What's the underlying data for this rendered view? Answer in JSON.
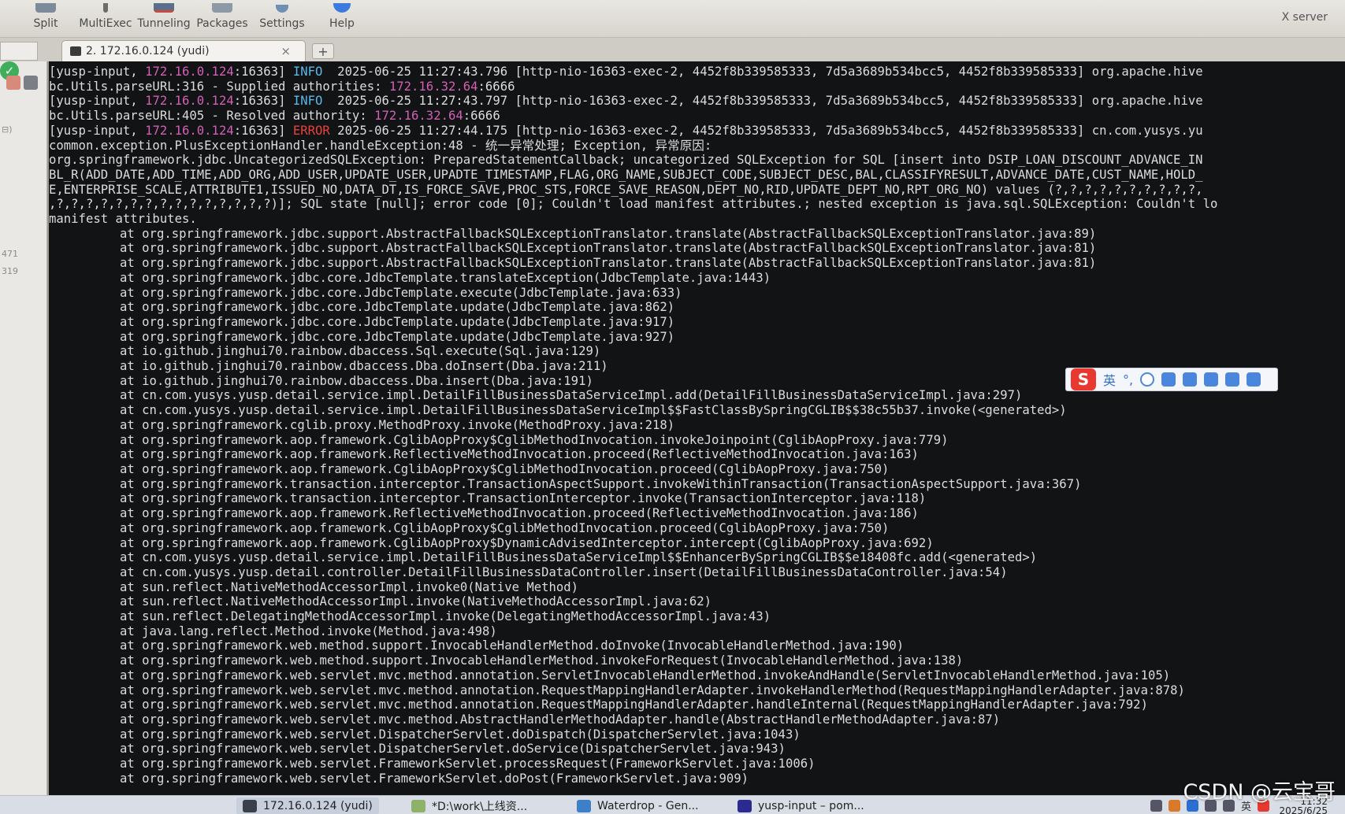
{
  "toolbar": {
    "buttons": [
      {
        "label": "Split",
        "icon": "split-icon"
      },
      {
        "label": "MultiExec",
        "icon": "multiexec-icon"
      },
      {
        "label": "Tunneling",
        "icon": "tunneling-icon"
      },
      {
        "label": "Packages",
        "icon": "packages-icon"
      },
      {
        "label": "Settings",
        "icon": "gear-icon"
      },
      {
        "label": "Help",
        "icon": "help-icon"
      }
    ],
    "xserver_label": "X server"
  },
  "tabs": {
    "active_label": "2. 172.16.0.124 (yudi)",
    "close_glyph": "×",
    "add_glyph": "+"
  },
  "sidepanel": {
    "labels": [
      "⊟)",
      "471",
      "319"
    ]
  },
  "terminal": {
    "log_lines": [
      {
        "pre": "[yusp-input, ",
        "ip": "172.16.0.124",
        "mid": ":16363] ",
        "level": "INFO",
        "level_class": "c-info",
        "post": "  2025-06-25 11:27:43.796 [http-nio-16363-exec-2, 4452f8b339585333, 7d5a3689b534bcc5, 4452f8b339585333] org.apache.hive"
      },
      {
        "pre": "bc.Utils.parseURL:316 - Supplied authorities: ",
        "ip": "172.16.32.64",
        "mid": ":6666",
        "level": "",
        "level_class": "",
        "post": ""
      },
      {
        "pre": "[yusp-input, ",
        "ip": "172.16.0.124",
        "mid": ":16363] ",
        "level": "INFO",
        "level_class": "c-info",
        "post": "  2025-06-25 11:27:43.797 [http-nio-16363-exec-2, 4452f8b339585333, 7d5a3689b534bcc5, 4452f8b339585333] org.apache.hive"
      },
      {
        "pre": "bc.Utils.parseURL:405 - Resolved authority: ",
        "ip": "172.16.32.64",
        "mid": ":6666",
        "level": "",
        "level_class": "",
        "post": ""
      },
      {
        "pre": "[yusp-input, ",
        "ip": "172.16.0.124",
        "mid": ":16363] ",
        "level": "ERROR",
        "level_class": "c-err",
        "post": " 2025-06-25 11:27:44.175 [http-nio-16363-exec-2, 4452f8b339585333, 7d5a3689b534bcc5, 4452f8b339585333] cn.com.yusys.yu"
      }
    ],
    "exception_lines": [
      "common.exception.PlusExceptionHandler.handleException:48 - 统一异常处理; Exception, 异常原因:",
      "org.springframework.jdbc.UncategorizedSQLException: PreparedStatementCallback; uncategorized SQLException for SQL [insert into DSIP_LOAN_DISCOUNT_ADVANCE_IN",
      "BL_R(ADD_DATE,ADD_TIME,ADD_ORG,ADD_USER,UPDATE_USER,UPADTE_TIMESTAMP,FLAG,ORG_NAME,SUBJECT_CODE,SUBJECT_DESC,BAL,CLASSIFYRESULT,ADVANCE_DATE,CUST_NAME,HOLD_",
      "E,ENTERPRISE_SCALE,ATTRIBUTE1,ISSUED_NO,DATA_DT,IS_FORCE_SAVE,PROC_STS,FORCE_SAVE_REASON,DEPT_NO,RID,UPDATE_DEPT_NO,RPT_ORG_NO) values (?,?,?,?,?,?,?,?,?,?,",
      ",?,?,?,?,?,?,?,?,?,?,?,?,?,?,?)]; SQL state [null]; error code [0]; Couldn't load manifest attributes.; nested exception is java.sql.SQLException: Couldn't lo",
      "manifest attributes."
    ],
    "stack_frames": [
      "at org.springframework.jdbc.support.AbstractFallbackSQLExceptionTranslator.translate(AbstractFallbackSQLExceptionTranslator.java:89)",
      "at org.springframework.jdbc.support.AbstractFallbackSQLExceptionTranslator.translate(AbstractFallbackSQLExceptionTranslator.java:81)",
      "at org.springframework.jdbc.support.AbstractFallbackSQLExceptionTranslator.translate(AbstractFallbackSQLExceptionTranslator.java:81)",
      "at org.springframework.jdbc.core.JdbcTemplate.translateException(JdbcTemplate.java:1443)",
      "at org.springframework.jdbc.core.JdbcTemplate.execute(JdbcTemplate.java:633)",
      "at org.springframework.jdbc.core.JdbcTemplate.update(JdbcTemplate.java:862)",
      "at org.springframework.jdbc.core.JdbcTemplate.update(JdbcTemplate.java:917)",
      "at org.springframework.jdbc.core.JdbcTemplate.update(JdbcTemplate.java:927)",
      "at io.github.jinghui70.rainbow.dbaccess.Sql.execute(Sql.java:129)",
      "at io.github.jinghui70.rainbow.dbaccess.Dba.doInsert(Dba.java:211)",
      "at io.github.jinghui70.rainbow.dbaccess.Dba.insert(Dba.java:191)",
      "at cn.com.yusys.yusp.detail.service.impl.DetailFillBusinessDataServiceImpl.add(DetailFillBusinessDataServiceImpl.java:297)",
      "at cn.com.yusys.yusp.detail.service.impl.DetailFillBusinessDataServiceImpl$$FastClassBySpringCGLIB$$38c55b37.invoke(<generated>)",
      "at org.springframework.cglib.proxy.MethodProxy.invoke(MethodProxy.java:218)",
      "at org.springframework.aop.framework.CglibAopProxy$CglibMethodInvocation.invokeJoinpoint(CglibAopProxy.java:779)",
      "at org.springframework.aop.framework.ReflectiveMethodInvocation.proceed(ReflectiveMethodInvocation.java:163)",
      "at org.springframework.aop.framework.CglibAopProxy$CglibMethodInvocation.proceed(CglibAopProxy.java:750)",
      "at org.springframework.transaction.interceptor.TransactionAspectSupport.invokeWithinTransaction(TransactionAspectSupport.java:367)",
      "at org.springframework.transaction.interceptor.TransactionInterceptor.invoke(TransactionInterceptor.java:118)",
      "at org.springframework.aop.framework.ReflectiveMethodInvocation.proceed(ReflectiveMethodInvocation.java:186)",
      "at org.springframework.aop.framework.CglibAopProxy$CglibMethodInvocation.proceed(CglibAopProxy.java:750)",
      "at org.springframework.aop.framework.CglibAopProxy$DynamicAdvisedInterceptor.intercept(CglibAopProxy.java:692)",
      "at cn.com.yusys.yusp.detail.service.impl.DetailFillBusinessDataServiceImpl$$EnhancerBySpringCGLIB$$e18408fc.add(<generated>)",
      "at cn.com.yusys.yusp.detail.controller.DetailFillBusinessDataController.insert(DetailFillBusinessDataController.java:54)",
      "at sun.reflect.NativeMethodAccessorImpl.invoke0(Native Method)",
      "at sun.reflect.NativeMethodAccessorImpl.invoke(NativeMethodAccessorImpl.java:62)",
      "at sun.reflect.DelegatingMethodAccessorImpl.invoke(DelegatingMethodAccessorImpl.java:43)",
      "at java.lang.reflect.Method.invoke(Method.java:498)",
      "at org.springframework.web.method.support.InvocableHandlerMethod.doInvoke(InvocableHandlerMethod.java:190)",
      "at org.springframework.web.method.support.InvocableHandlerMethod.invokeForRequest(InvocableHandlerMethod.java:138)",
      "at org.springframework.web.servlet.mvc.method.annotation.ServletInvocableHandlerMethod.invokeAndHandle(ServletInvocableHandlerMethod.java:105)",
      "at org.springframework.web.servlet.mvc.method.annotation.RequestMappingHandlerAdapter.invokeHandlerMethod(RequestMappingHandlerAdapter.java:878)",
      "at org.springframework.web.servlet.mvc.method.annotation.RequestMappingHandlerAdapter.handleInternal(RequestMappingHandlerAdapter.java:792)",
      "at org.springframework.web.servlet.mvc.method.AbstractHandlerMethodAdapter.handle(AbstractHandlerMethodAdapter.java:87)",
      "at org.springframework.web.servlet.DispatcherServlet.doDispatch(DispatcherServlet.java:1043)",
      "at org.springframework.web.servlet.DispatcherServlet.doService(DispatcherServlet.java:943)",
      "at org.springframework.web.servlet.FrameworkServlet.processRequest(FrameworkServlet.java:1006)",
      "at org.springframework.web.servlet.FrameworkServlet.doPost(FrameworkServlet.java:909)"
    ]
  },
  "ime_toolbar": {
    "logo": "S",
    "mode": "英",
    "punct": "°,"
  },
  "taskbar": {
    "tasks": [
      {
        "label": "172.16.0.124 (yudi)",
        "icon": "terminal-icon",
        "active": true
      },
      {
        "label": "*D:\\work\\上线资...",
        "icon": "notepad-icon",
        "active": false
      },
      {
        "label": "Waterdrop - Gen...",
        "icon": "waterdrop-icon",
        "active": false
      },
      {
        "label": "yusp-input – pom...",
        "icon": "idea-icon",
        "active": false
      }
    ],
    "tray_lang": "英",
    "time": "11:32",
    "date": "2025/6/25"
  },
  "watermark": "CSDN @云宝哥",
  "colors": {
    "terminal_bg": "#111315",
    "terminal_fg": "#dcdcdc",
    "ip_color": "#d45fb6",
    "info_color": "#59b8e8",
    "error_color": "#e8423a"
  }
}
